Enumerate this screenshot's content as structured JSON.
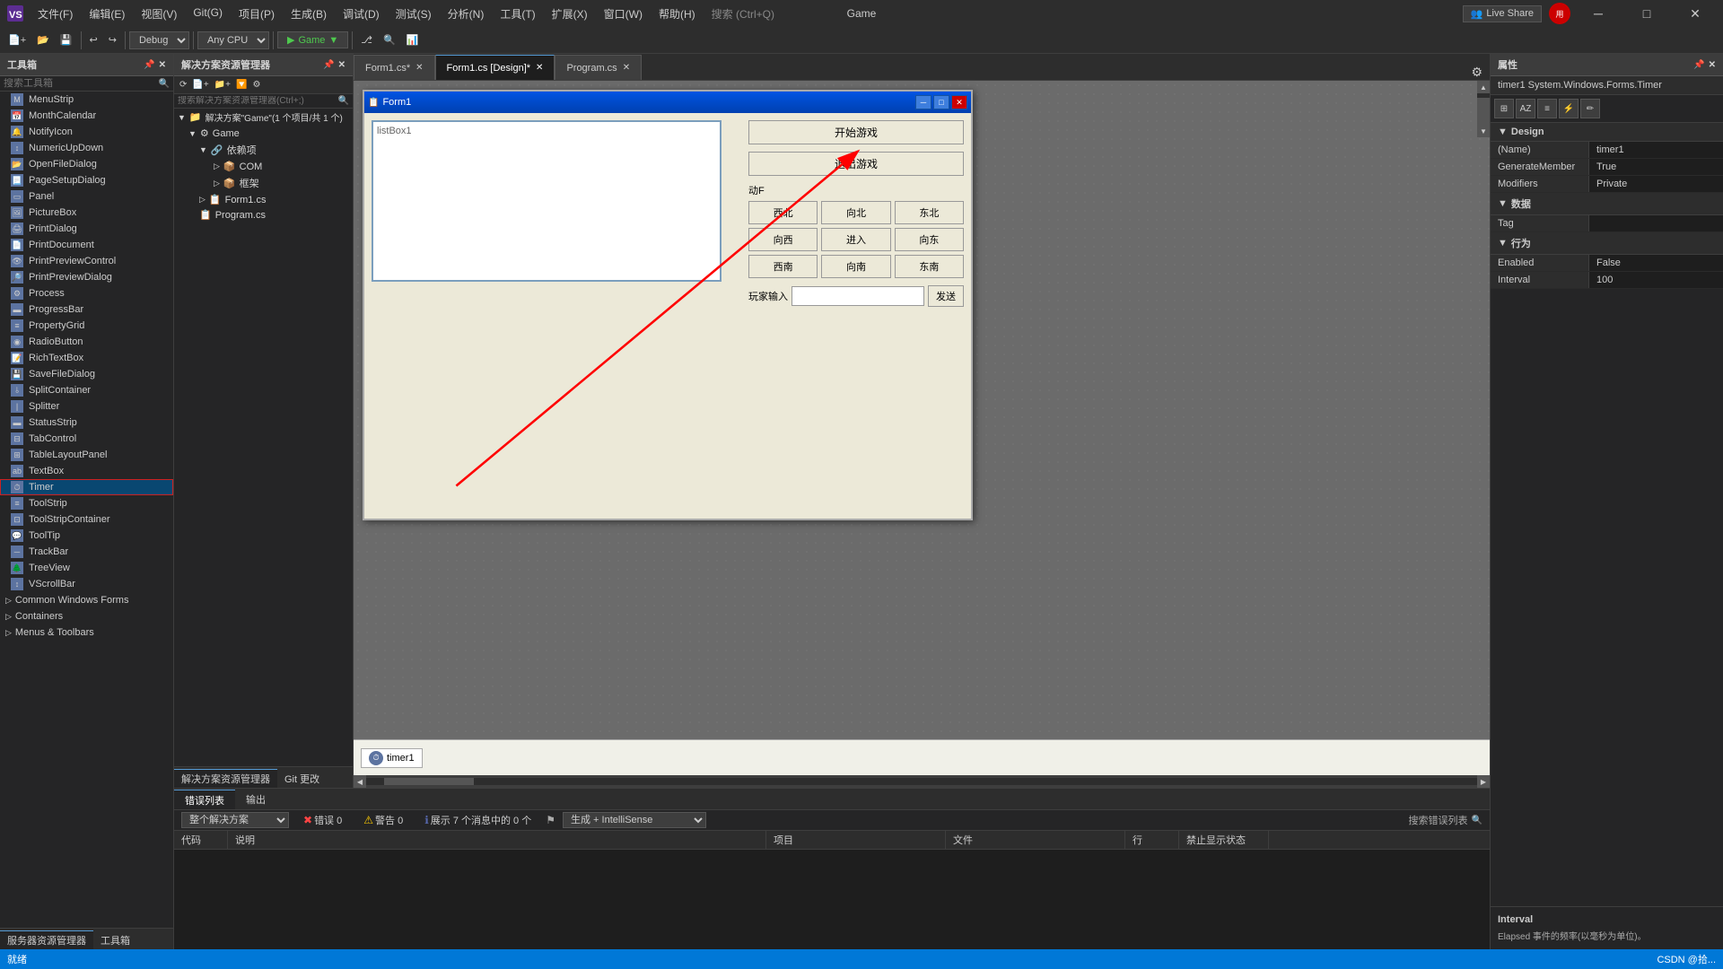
{
  "app": {
    "title": "Game",
    "logo_text": "VS"
  },
  "menu": {
    "items": [
      "文件(F)",
      "编辑(E)",
      "视图(V)",
      "Git(G)",
      "项目(P)",
      "生成(B)",
      "调试(D)",
      "测试(S)",
      "分析(N)",
      "工具(T)",
      "扩展(X)",
      "窗口(W)",
      "帮助(H)",
      "搜索 (Ctrl+Q)"
    ]
  },
  "toolbar": {
    "debug_config": "Debug",
    "platform": "Any CPU",
    "run_label": "▶ Game",
    "live_share_label": "Live Share"
  },
  "toolbox": {
    "title": "工具箱",
    "search_placeholder": "搜索工具箱",
    "items": [
      "MenuStrip",
      "MonthCalendar",
      "NotifyIcon",
      "NumericUpDown",
      "OpenFileDialog",
      "PageSetupDialog",
      "Panel",
      "PictureBox",
      "PrintDialog",
      "PrintDocument",
      "PrintPreviewControl",
      "PrintPreviewDialog",
      "Process",
      "ProgressBar",
      "PropertyGrid",
      "RadioButton",
      "RichTextBox",
      "SaveFileDialog",
      "SplitContainer",
      "Splitter",
      "StatusStrip",
      "TabControl",
      "TableLayoutPanel",
      "TextBox",
      "Timer",
      "ToolStrip",
      "ToolStripContainer",
      "ToolTip",
      "TrackBar",
      "TreeView",
      "VScrollBar"
    ],
    "selected_item": "Timer",
    "section_items": [
      "Common Windows Forms",
      "Containers",
      "Menus & Toolbars"
    ]
  },
  "solution_explorer": {
    "title": "解决方案资源管理器",
    "search_placeholder": "搜索解决方案资源管理器(Ctrl+;)",
    "solution_name": "解决方案\"Game\"(1 个项目/共 1 个)",
    "project_name": "Game",
    "tree": {
      "dependencies": "依赖项",
      "com": "COM",
      "framework": "框架",
      "form1_cs": "Form1.cs",
      "program_cs": "Program.cs"
    }
  },
  "tabs": {
    "items": [
      {
        "label": "Form1.cs*",
        "active": false
      },
      {
        "label": "Form1.cs [Design]*",
        "active": true
      },
      {
        "label": "Program.cs",
        "active": false
      }
    ]
  },
  "form_designer": {
    "form_title": "Form1",
    "buttons": {
      "start_game": "开始游戏",
      "exit_game": "退出游戏",
      "move_label": "动F",
      "directions": [
        "西北",
        "向北",
        "东北",
        "向西",
        "进入",
        "向东",
        "西南",
        "向南",
        "东南"
      ],
      "player_input_label": "玩家输入",
      "send_label": "发送"
    },
    "list_box_label": "listBox1",
    "timer_label": "timer1"
  },
  "properties": {
    "title": "属性",
    "object_name": "timer1  System.Windows.Forms.Timer",
    "sections": {
      "design": {
        "title": "Design",
        "rows": [
          {
            "name": "(Name)",
            "value": "timer1"
          },
          {
            "name": "GenerateMember",
            "value": "True"
          },
          {
            "name": "Modifiers",
            "value": "Private"
          }
        ]
      },
      "data": {
        "title": "数据",
        "rows": [
          {
            "name": "Tag",
            "value": ""
          }
        ]
      },
      "behavior": {
        "title": "行为",
        "rows": [
          {
            "name": "Enabled",
            "value": "False"
          },
          {
            "name": "Interval",
            "value": "100"
          }
        ]
      }
    },
    "description": {
      "title": "Interval",
      "text": "Elapsed 事件的频率(以毫秒为单位)。"
    }
  },
  "bottom_panel": {
    "tabs": [
      "错误列表",
      "输出"
    ],
    "active_tab": "错误列表",
    "title": "错误列表",
    "scope": "整个解决方案",
    "error_count": "错误 0",
    "warning_count": "警告 0",
    "info_count": "展示 7 个消息中的 0 个",
    "build_config": "生成 + IntelliSense",
    "search_placeholder": "搜索错误列表",
    "columns": [
      "代码",
      "说明",
      "项目",
      "文件",
      "行",
      "禁止显示状态"
    ]
  },
  "status_bar": {
    "status": "就绪",
    "right_items": [
      "CSDN @拾..."
    ]
  },
  "bottom_section_tabs": [
    "服务器资源管理器",
    "Git 更改"
  ]
}
